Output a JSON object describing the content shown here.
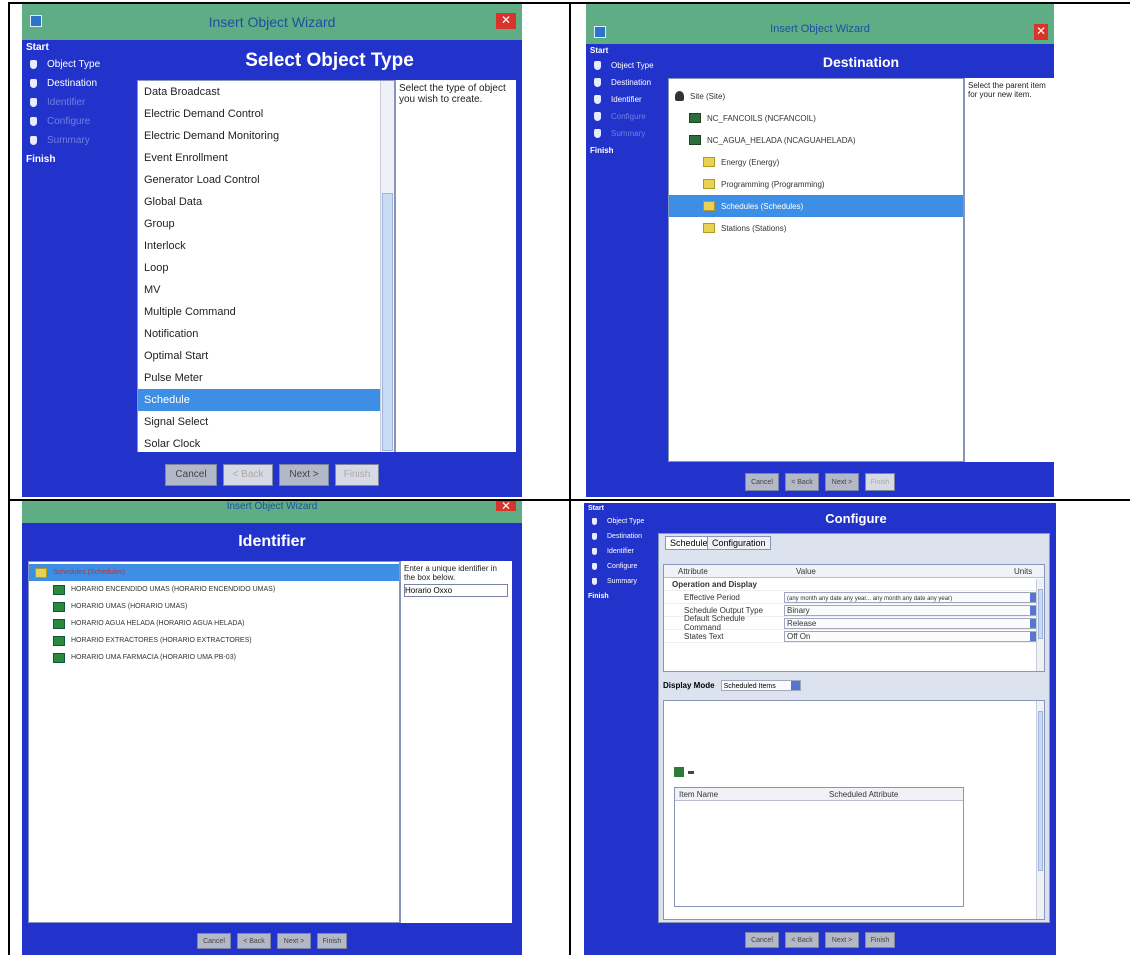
{
  "panel1": {
    "title": "Insert Object Wizard",
    "heading": "Select Object Type",
    "sidebar": {
      "start": "Start",
      "steps": [
        "Object Type",
        "Destination",
        "Identifier",
        "Configure",
        "Summary"
      ],
      "finish": "Finish"
    },
    "items": [
      "Data Broadcast",
      "Electric Demand Control",
      "Electric Demand Monitoring",
      "Event Enrollment",
      "Generator Load Control",
      "Global Data",
      "Group",
      "Interlock",
      "Loop",
      "MV",
      "Multiple Command",
      "Notification",
      "Optimal Start",
      "Pulse Meter",
      "Schedule",
      "Signal Select",
      "Solar Clock"
    ],
    "selected_index": 14,
    "description": "Select the type of object you wish to create.",
    "buttons": [
      "Cancel",
      "< Back",
      "Next >",
      "Finish"
    ]
  },
  "panel2": {
    "title": "Insert Object Wizard",
    "heading": "Destination",
    "sidebar": {
      "start": "Start",
      "steps": [
        "Object Type",
        "Destination",
        "Identifier",
        "Configure",
        "Summary"
      ],
      "finish": "Finish"
    },
    "tree": [
      {
        "label": "Site (Site)",
        "icon": "person-icon",
        "level": 0
      },
      {
        "label": "NC_FANCOILS (NCFANCOIL)",
        "icon": "block-icon",
        "level": 1
      },
      {
        "label": "NC_AGUA_HELADA (NCAGUAHELADA)",
        "icon": "block-icon",
        "level": 1
      },
      {
        "label": "Energy (Energy)",
        "icon": "folder-icon",
        "level": 2
      },
      {
        "label": "Programming (Programming)",
        "icon": "folder-icon",
        "level": 2
      },
      {
        "label": "Schedules (Schedules)",
        "icon": "folder-icon",
        "level": 2
      },
      {
        "label": "Stations (Stations)",
        "icon": "folder-icon",
        "level": 2
      }
    ],
    "selected_index": 5,
    "description": "Select the parent item for your new item.",
    "buttons": [
      "Cancel",
      "< Back",
      "Next >",
      "Finish"
    ]
  },
  "panel3": {
    "title": "Insert Object Wizard",
    "heading": "Identifier",
    "tree": [
      {
        "label": "Schedules (Schedules)",
        "icon": "folder-icon",
        "level": 0
      },
      {
        "label": "HORARIO ENCENDIDO UMAS (HORARIO ENCENDIDO UMAS)",
        "icon": "schedule-icon",
        "level": 1
      },
      {
        "label": "HORARIO UMAS (HORARIO UMAS)",
        "icon": "schedule-icon",
        "level": 1
      },
      {
        "label": "HORARIO AGUA HELADA (HORARIO AGUA HELADA)",
        "icon": "schedule-icon",
        "level": 1
      },
      {
        "label": "HORARIO EXTRACTORES (HORARIO EXTRACTORES)",
        "icon": "schedule-icon",
        "level": 1
      },
      {
        "label": "HORARIO UMA FARMACIA (HORARIO UMA PB-03)",
        "icon": "schedule-icon",
        "level": 1
      }
    ],
    "description": "Enter a unique identifier in the box below.",
    "identifier_value": "Horario Oxxo",
    "buttons": [
      "Cancel",
      "< Back",
      "Next >",
      "Finish"
    ]
  },
  "panel4": {
    "heading": "Configure",
    "sidebar": {
      "start": "Start",
      "steps": [
        "Object Type",
        "Destination",
        "Identifier",
        "Configure",
        "Summary"
      ],
      "finish": "Finish"
    },
    "tabs": [
      "Schedule",
      "Configuration"
    ],
    "columns": [
      "Attribute",
      "Value",
      "Units"
    ],
    "group": "Operation and Display",
    "rows": [
      {
        "attribute": "Effective Period",
        "value": "(any month any date any year... any month any date any year)"
      },
      {
        "attribute": "Schedule Output Type",
        "value": "Binary"
      },
      {
        "attribute": "Default Schedule Command",
        "value": "Release"
      },
      {
        "attribute": "States Text",
        "value": "Off On"
      }
    ],
    "display_mode_label": "Display Mode",
    "display_mode_value": "Scheduled Items",
    "items_columns": [
      "Item Name",
      "Scheduled Attribute"
    ],
    "buttons": [
      "Cancel",
      "< Back",
      "Next >",
      "Finish"
    ]
  }
}
